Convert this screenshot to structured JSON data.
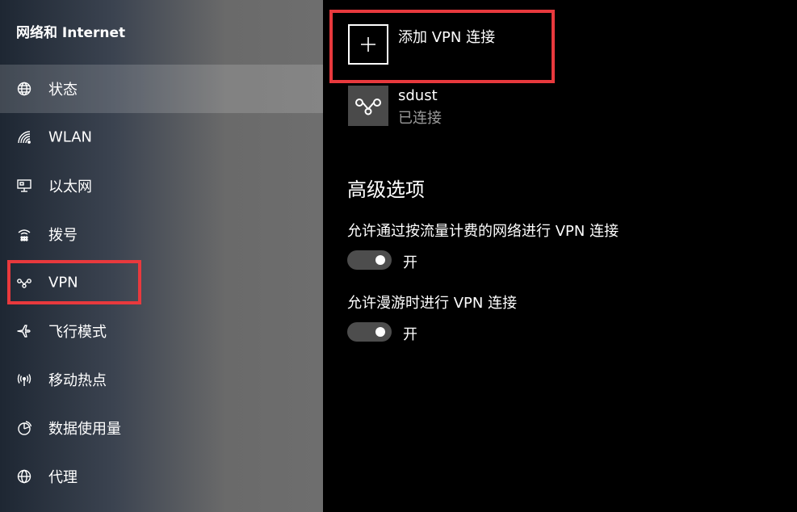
{
  "sidebar": {
    "title": "网络和 Internet",
    "items": [
      {
        "label": "状态",
        "icon": "globe-status-icon"
      },
      {
        "label": "WLAN",
        "icon": "wifi-icon"
      },
      {
        "label": "以太网",
        "icon": "ethernet-icon"
      },
      {
        "label": "拨号",
        "icon": "dialup-icon"
      },
      {
        "label": "VPN",
        "icon": "vpn-icon"
      },
      {
        "label": "飞行模式",
        "icon": "airplane-icon"
      },
      {
        "label": "移动热点",
        "icon": "hotspot-icon"
      },
      {
        "label": "数据使用量",
        "icon": "data-usage-icon"
      },
      {
        "label": "代理",
        "icon": "globe-proxy-icon"
      }
    ],
    "selected_index": 0
  },
  "main": {
    "add_vpn_label": "添加 VPN 连接",
    "connections": [
      {
        "name": "sdust",
        "status": "已连接",
        "icon": "vpn-icon"
      }
    ],
    "advanced_title": "高级选项",
    "options": [
      {
        "label": "允许通过按流量计费的网络进行 VPN 连接",
        "state": "开",
        "on": true
      },
      {
        "label": "允许漫游时进行 VPN 连接",
        "state": "开",
        "on": true
      }
    ]
  },
  "colors": {
    "highlight": "#e8393d",
    "background": "#000000",
    "toggle_track": "#4d4d4d",
    "secondary_text": "#9a9a9a",
    "connection_icon_bg": "#4a4a4a"
  }
}
